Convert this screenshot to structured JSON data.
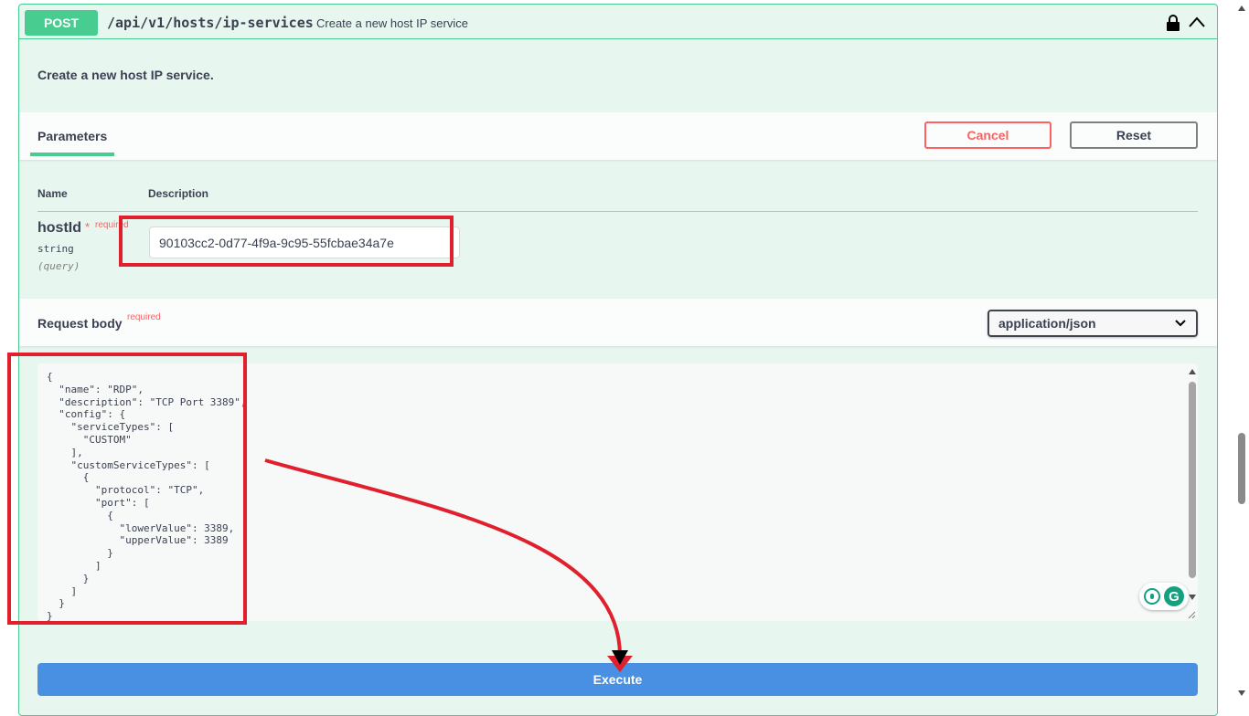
{
  "operation": {
    "method": "POST",
    "path": "/api/v1/hosts/ip-services",
    "summary": "Create a new host IP service",
    "description": "Create a new host IP service."
  },
  "parameters": {
    "tab_label": "Parameters",
    "cancel_label": "Cancel",
    "reset_label": "Reset",
    "col_name": "Name",
    "col_description": "Description",
    "items": [
      {
        "name": "hostId",
        "required_star": "*",
        "required_label": "required",
        "type": "string",
        "in": "(query)",
        "value": "90103cc2-0d77-4f9a-9c95-55fcbae34a7e"
      }
    ]
  },
  "request_body": {
    "label": "Request body",
    "required_label": "required",
    "content_type": "application/json",
    "code": "{\n  \"name\": \"RDP\",\n  \"description\": \"TCP Port 3389\",\n  \"config\": {\n    \"serviceTypes\": [\n      \"CUSTOM\"\n    ],\n    \"customServiceTypes\": [\n      {\n        \"protocol\": \"TCP\",\n        \"port\": [\n          {\n            \"lowerValue\": 3389,\n            \"upperValue\": 3389\n          }\n        ]\n      }\n    ]\n  }\n}"
  },
  "execute_label": "Execute",
  "colors": {
    "post_green": "#49cc90",
    "execute_blue": "#4990e2",
    "annotation_red": "#e0202d",
    "cancel_red": "#ff6060"
  }
}
